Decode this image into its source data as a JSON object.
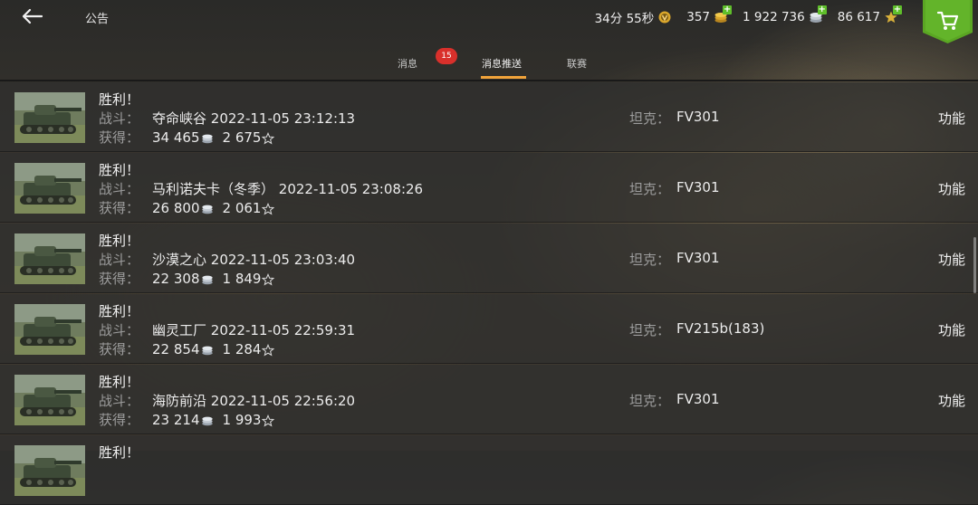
{
  "header": {
    "title": "公告",
    "timer": "34分 55秒",
    "gold": "357",
    "credits": "1 922 736",
    "free_xp": "86 617"
  },
  "tabs": [
    {
      "label": "消息"
    },
    {
      "label": "消息推送"
    },
    {
      "label": "联赛"
    }
  ],
  "badge_count": "15",
  "active_tab": "消息推送",
  "labels": {
    "battle": "战斗：",
    "earned": "获得：",
    "tank": "坦克：",
    "func": "功能"
  },
  "rows": [
    {
      "result": "胜利！",
      "battle": "夺命峡谷 2022-11-05 23:12:13",
      "credits": "34 465",
      "xp": "2 675",
      "tank": "FV301"
    },
    {
      "result": "胜利！",
      "battle": "马利诺夫卡（冬季） 2022-11-05 23:08:26",
      "credits": "26 800",
      "xp": "2 061",
      "tank": "FV301"
    },
    {
      "result": "胜利！",
      "battle": "沙漠之心 2022-11-05 23:03:40",
      "credits": "22 308",
      "xp": "1 849",
      "tank": "FV301"
    },
    {
      "result": "胜利！",
      "battle": "幽灵工厂 2022-11-05 22:59:31",
      "credits": "22 854",
      "xp": "1 284",
      "tank": "FV215b(183)"
    },
    {
      "result": "胜利！",
      "battle": "海防前沿 2022-11-05 22:56:20",
      "credits": "23 214",
      "xp": "1 993",
      "tank": "FV301"
    },
    {
      "result": "胜利！",
      "battle": "",
      "credits": "",
      "xp": "",
      "tank": ""
    }
  ],
  "colors": {
    "accent": "#f0a33a",
    "badge": "#d9302b",
    "cart": "#5aa623"
  }
}
